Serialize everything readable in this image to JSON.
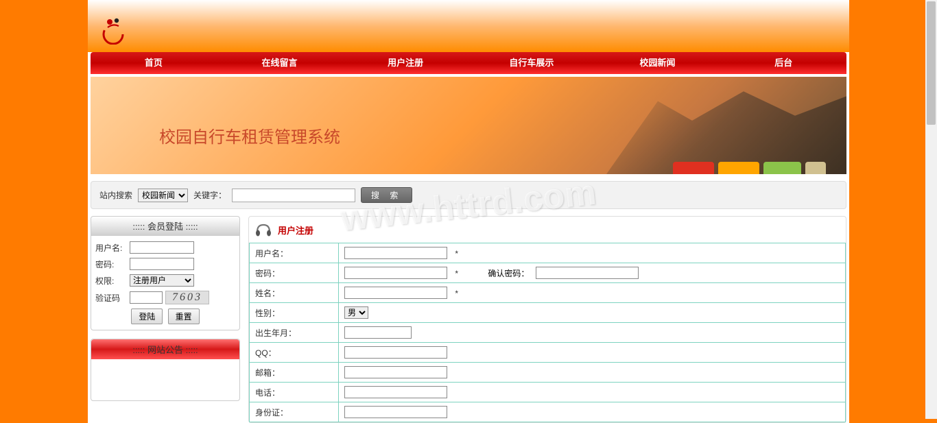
{
  "banner": {
    "title": "校园自行车租赁管理系统"
  },
  "nav": [
    {
      "label": "首页"
    },
    {
      "label": "在线留言"
    },
    {
      "label": "用户注册"
    },
    {
      "label": "自行车展示"
    },
    {
      "label": "校园新闻"
    },
    {
      "label": "后台"
    }
  ],
  "search": {
    "label": "站内搜索",
    "category_option": "校园新闻",
    "keyword_label": "关键字：",
    "button": "搜 索"
  },
  "login": {
    "header": "::::: 会员登陆 :::::",
    "username_label": "用户名:",
    "password_label": "密码:",
    "role_label": "权限:",
    "role_option": "注册用户",
    "captcha_label": "验证码",
    "captcha_value": "7603",
    "login_btn": "登陆",
    "reset_btn": "重置"
  },
  "notice": {
    "header": "::::: 网站公告 :::::"
  },
  "reg": {
    "panel_title": "用户注册",
    "fields": {
      "username": "用户名：",
      "password": "密码：",
      "confirm": "确认密码：",
      "realname": "姓名：",
      "gender": "性别：",
      "gender_option": "男",
      "birth": "出生年月：",
      "qq": "QQ：",
      "email": "邮箱：",
      "phone": "电话：",
      "idcard": "身份证："
    },
    "star": "*"
  },
  "watermark": "www.httrd.com"
}
